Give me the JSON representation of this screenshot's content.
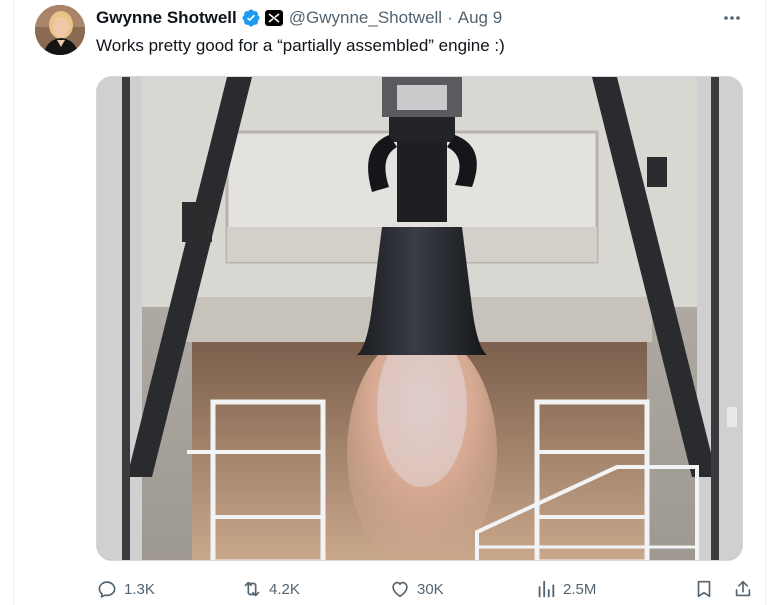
{
  "tweet": {
    "author": {
      "display_name": "Gwynne Shotwell",
      "handle": "@Gwynne_Shotwell",
      "verified": true,
      "affiliation_badge": "spacex-x-icon"
    },
    "separator": "·",
    "date": "Aug 9",
    "text": "Works pretty good for a “partially assembled” engine :)",
    "media": {
      "description_icon": "rocket-engine-test-photo"
    },
    "actions": {
      "replies": "1.3K",
      "reposts": "4.2K",
      "likes": "30K",
      "views": "2.5M"
    }
  },
  "colors": {
    "text_primary": "#0f1419",
    "text_secondary": "#536471",
    "verified_blue": "#1d9bf0",
    "border": "#cfd9de"
  },
  "icons": [
    "verified-badge-icon",
    "affiliation-badge-icon",
    "more-icon",
    "reply-icon",
    "repost-icon",
    "like-icon",
    "views-icon",
    "bookmark-icon",
    "share-icon"
  ]
}
